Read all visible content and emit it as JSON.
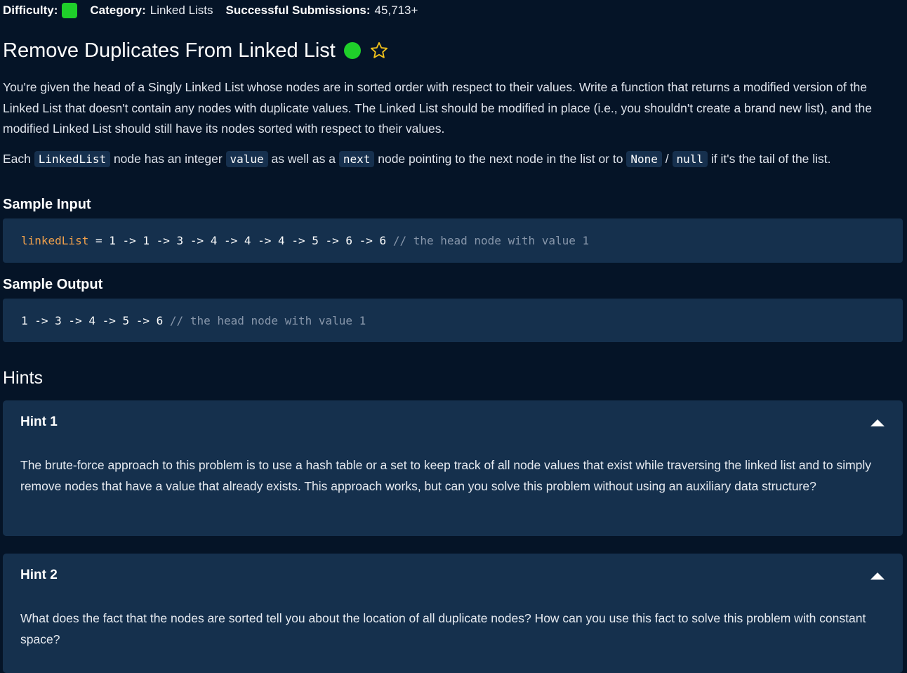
{
  "meta": {
    "difficulty_label": "Difficulty:",
    "category_label": "Category:",
    "category_value": "Linked Lists",
    "submissions_label": "Successful Submissions:",
    "submissions_value": "45,713+",
    "difficulty_color": "#1fcf2a"
  },
  "problem": {
    "title": "Remove Duplicates From Linked List",
    "status_color": "#1fcf2a",
    "favorite_icon": "star-outline-icon",
    "description": "You're given the head of a Singly Linked List whose nodes are in sorted order with respect to their values. Write a function that returns a modified version of the Linked List that doesn't contain any nodes with duplicate values. The Linked List should be modified in place (i.e., you shouldn't create a brand new list), and the modified Linked List should still have its nodes sorted with respect to their values.",
    "node_desc": {
      "part1": "Each ",
      "code1": "LinkedList",
      "part2": " node has an integer ",
      "code2": "value",
      "part3": " as well as a ",
      "code3": "next",
      "part4": " node pointing to the next node in the list or to ",
      "code4": "None",
      "part5": " / ",
      "code5": "null",
      "part6": " if it's the tail of the list."
    }
  },
  "sample_input": {
    "heading": "Sample Input",
    "var": "linkedList",
    "expr": " = 1 -> 1 -> 3 -> 4 -> 4 -> 4 -> 5 -> 6 -> 6 ",
    "comment": "// the head node with value 1"
  },
  "sample_output": {
    "heading": "Sample Output",
    "expr": "1 -> 3 -> 4 -> 5 -> 6 ",
    "comment": "// the head node with value 1"
  },
  "hints": {
    "title": "Hints",
    "items": [
      {
        "label": "Hint 1",
        "text": "The brute-force approach to this problem is to use a hash table or a set to keep track of all node values that exist while traversing the linked list and to simply remove nodes that have a value that already exists. This approach works, but can you solve this problem without using an auxiliary data structure?"
      },
      {
        "label": "Hint 2",
        "text": "What does the fact that the nodes are sorted tell you about the location of all duplicate nodes? How can you use this fact to solve this problem with constant space?"
      }
    ]
  }
}
